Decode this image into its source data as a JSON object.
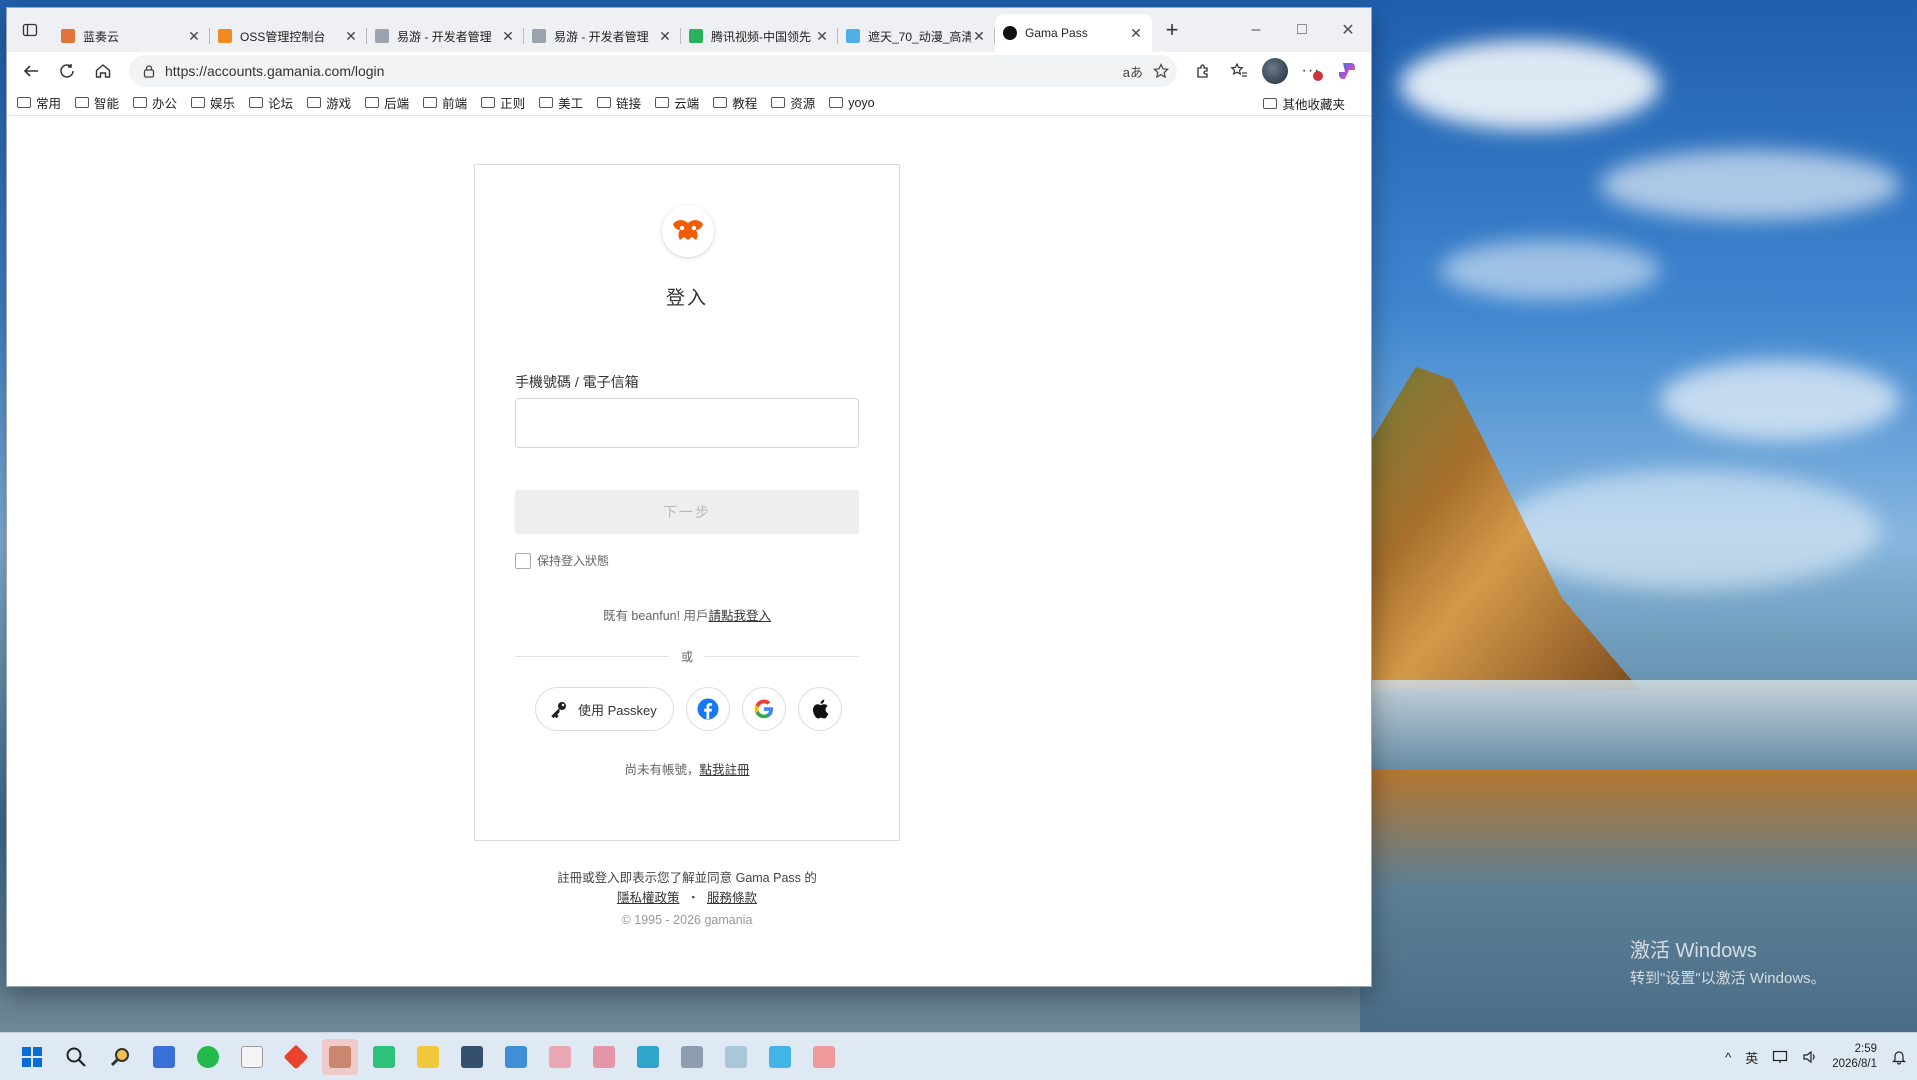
{
  "browser": {
    "tabs": [
      {
        "title": "蓝奏云",
        "favicon_color": "#e2733a"
      },
      {
        "title": "OSS管理控制台",
        "favicon_color": "#f08a24"
      },
      {
        "title": "易游 - 开发者管理",
        "favicon_color": "#9aa3ad"
      },
      {
        "title": "易游 - 开发者管理",
        "favicon_color": "#9aa3ad"
      },
      {
        "title": "腾讯视频-中国领先",
        "favicon_color": "#28b35b"
      },
      {
        "title": "遮天_70_动漫_高清",
        "favicon_color": "#4fb0e8"
      },
      {
        "title": "Gama Pass",
        "favicon_color": "#111111",
        "active": true
      }
    ],
    "url": "https://accounts.gamania.com/login",
    "bookmarks": [
      "常用",
      "智能",
      "办公",
      "娱乐",
      "论坛",
      "游戏",
      "后端",
      "前端",
      "正则",
      "美工",
      "链接",
      "云端",
      "教程",
      "资源",
      "yoyo"
    ],
    "other_bookmarks": "其他收藏夹"
  },
  "login": {
    "title": "登入",
    "field_label": "手機號碼 / 電子信箱",
    "input_value": "",
    "next_button": "下一步",
    "remember_label": "保持登入狀態",
    "beanfun_text": "既有 beanfun! 用戶",
    "beanfun_link": "請點我登入",
    "or_text": "或",
    "passkey_label": "使用 Passkey",
    "register_text": "尚未有帳號，",
    "register_link": "點我註冊",
    "terms_text": "註冊或登入即表示您了解並同意 Gama Pass 的",
    "privacy_link": "隱私權政策",
    "terms_separator": "・",
    "service_link": "服務條款",
    "copyright": "© 1995 - 2026 gamania",
    "brand_color": "#f25c05"
  },
  "desktop": {
    "activate_title": "激活 Windows",
    "activate_sub": "转到\"设置\"以激活 Windows。"
  },
  "taskbar": {
    "ime": "英",
    "time": "2:59",
    "date": "2026/8/1"
  }
}
